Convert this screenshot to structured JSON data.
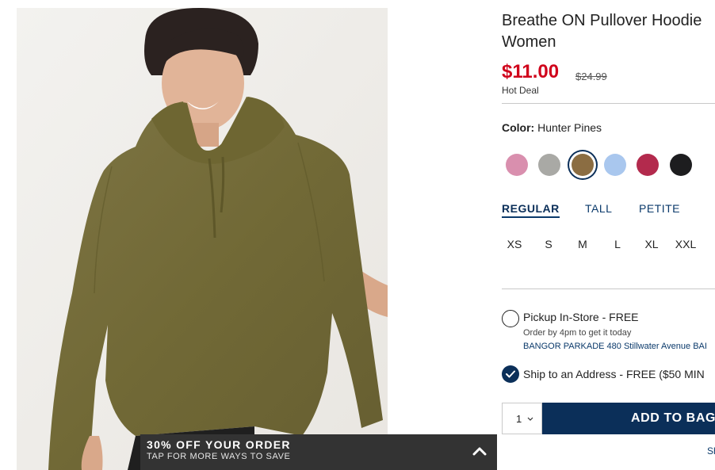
{
  "product": {
    "title_line1": "Breathe ON Pullover Hoodie",
    "title_line2": "Women",
    "price_now": "$11.00",
    "price_was": "$24.99",
    "badge": "Hot Deal"
  },
  "color": {
    "label": "Color:",
    "selected_name": "Hunter Pines",
    "swatches": [
      {
        "name": "pink",
        "hex": "#d98fae"
      },
      {
        "name": "light-gray",
        "hex": "#a9a9a5"
      },
      {
        "name": "hunter-pines",
        "hex": "#8b6d42",
        "selected": true
      },
      {
        "name": "light-blue",
        "hex": "#a9c7ee"
      },
      {
        "name": "berry",
        "hex": "#b32a4d"
      },
      {
        "name": "black",
        "hex": "#1d1d1f"
      }
    ]
  },
  "fit_tabs": [
    {
      "label": "REGULAR",
      "active": true
    },
    {
      "label": "TALL"
    },
    {
      "label": "PETITE"
    }
  ],
  "sizes": [
    "XS",
    "S",
    "M",
    "L",
    "XL",
    "XXL"
  ],
  "fulfillment": {
    "pickup_label": "Pickup In-Store - FREE",
    "pickup_note": "Order by 4pm to get it today",
    "pickup_store": "BANGOR PARKADE 480 Stillwater Avenue  BAI",
    "ship_label": "Ship to an Address - FREE ($50 MIN"
  },
  "cart": {
    "quantity": "1",
    "add_label": "ADD TO BAG",
    "share_label": "Sh"
  },
  "promo": {
    "title": "30% OFF YOUR ORDER",
    "subtitle": "TAP FOR MORE WAYS TO SAVE"
  },
  "colors": {
    "accent_navy": "#0b2f59",
    "sale_red": "#d0021b",
    "promo_bg": "#333333"
  }
}
